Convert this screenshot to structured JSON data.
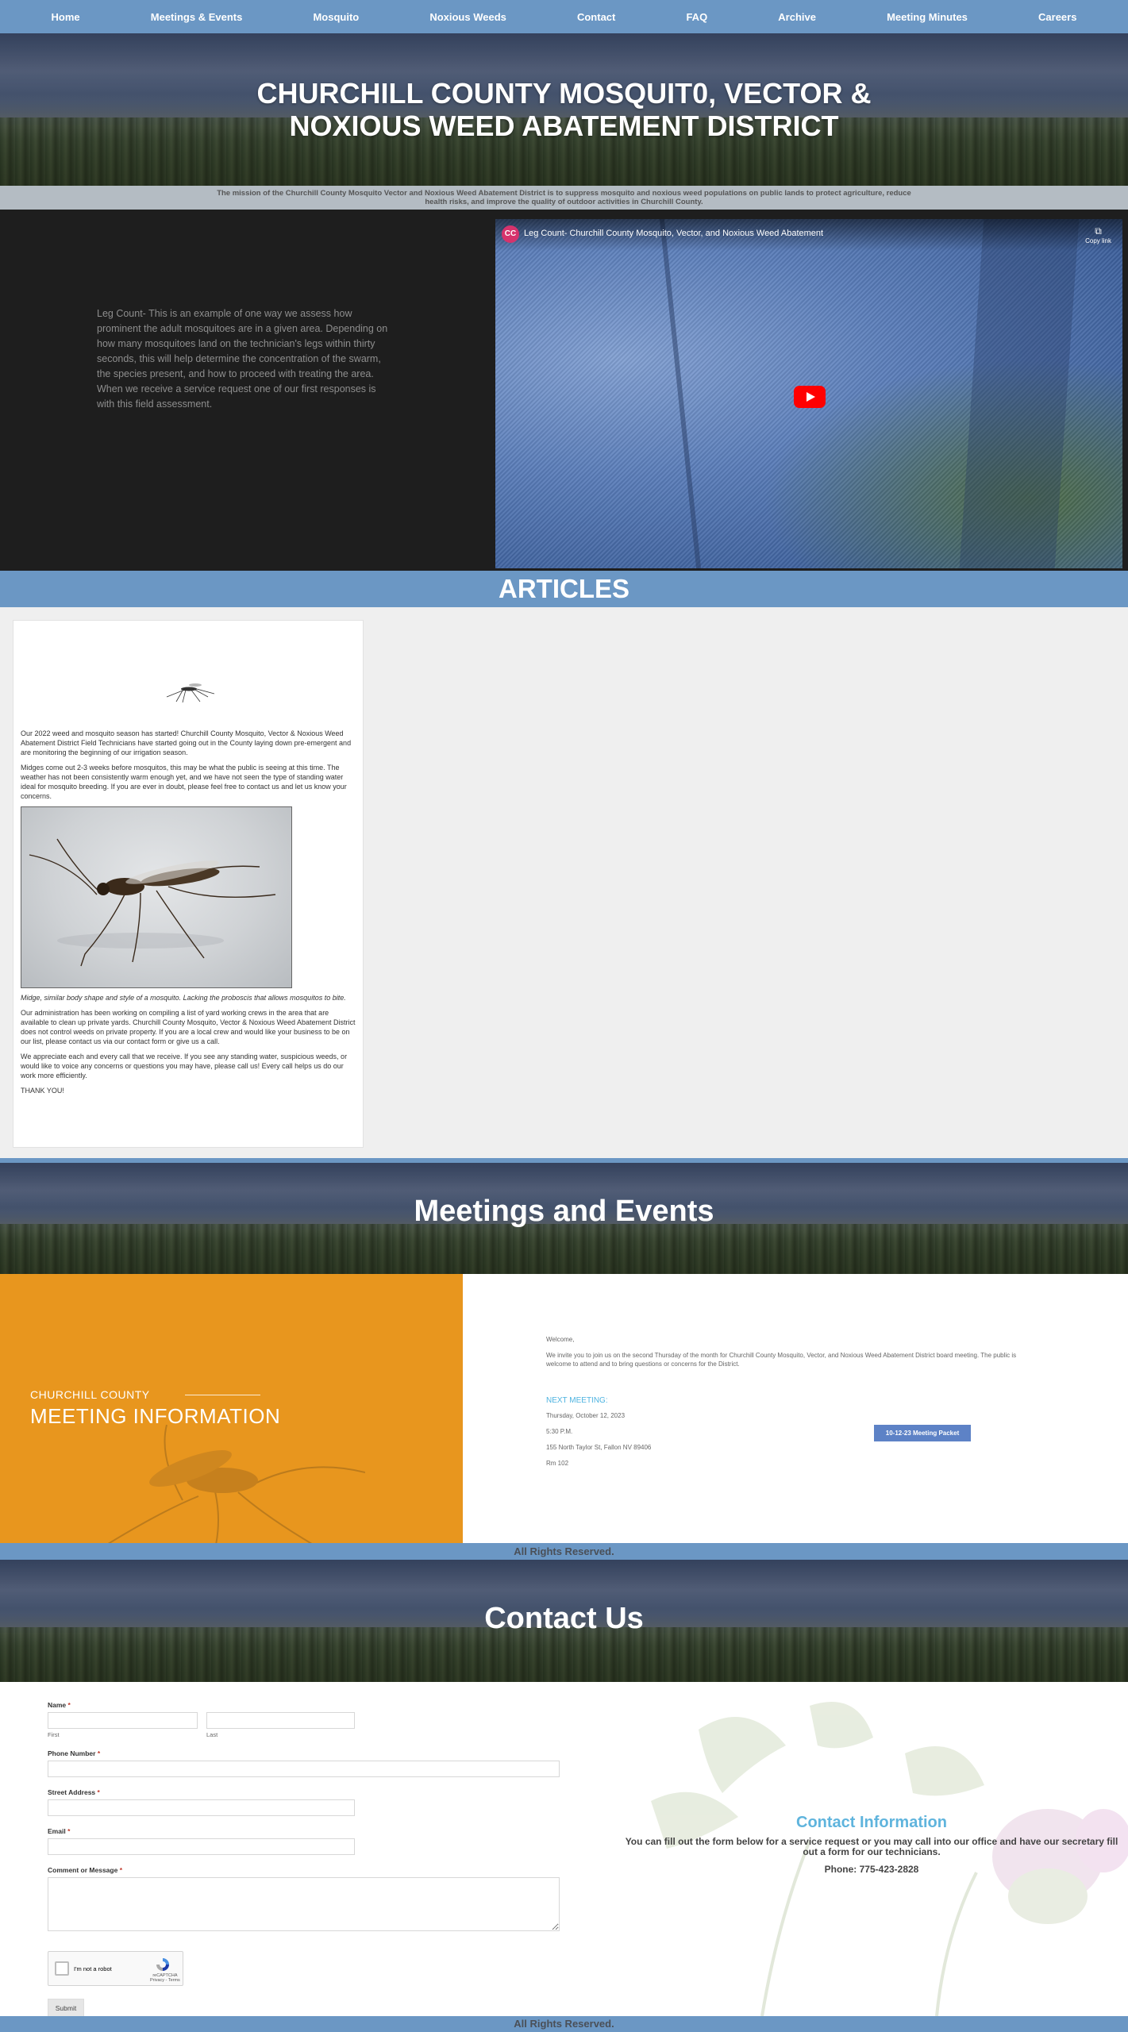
{
  "nav": {
    "items": [
      "Home",
      "Meetings & Events",
      "Mosquito",
      "Noxious Weeds",
      "Contact",
      "FAQ",
      "Archive",
      "Meeting Minutes",
      "Careers"
    ]
  },
  "hero": {
    "title_line1": "CHURCHILL COUNTY MOSQUIT0, VECTOR &",
    "title_line2": "NOXIOUS WEED ABATEMENT DISTRICT"
  },
  "mission": {
    "text": "The mission of the Churchill County Mosquito Vector and Noxious Weed Abatement District is to suppress mosquito and noxious weed populations on public lands to protect agriculture, reduce health risks, and improve the quality of outdoor activities in Churchill County."
  },
  "video": {
    "description": "Leg Count- This is an example of one way we assess how prominent the adult mosquitoes are in a given area. Depending on how many mosquitoes land on the technician's legs within thirty seconds, this will help determine the concentration of the swarm, the species present, and how to proceed with treating the area. When we receive a service request one of our first responses is with this field assessment.",
    "channel_initials": "CC",
    "title": "Leg Count- Churchill County Mosquito, Vector, and Noxious Weed Abatement",
    "copy_link": "Copy link",
    "icons": {
      "copy": "copy-icon",
      "play": "play-icon"
    }
  },
  "articles": {
    "heading": "ARTICLES",
    "p1": "Our 2022 weed and mosquito season has started! Churchill County Mosquito, Vector & Noxious Weed Abatement District Field Technicians have started going out in the County laying down pre-emergent and are monitoring the beginning of our irrigation season.",
    "p2": "Midges come out 2-3 weeks before mosquitos, this may be what the public is seeing at this time. The weather has not been consistently warm enough yet, and we have not seen the type of standing water ideal for mosquito breeding. If you are ever in doubt, please feel free to contact us and let us know your concerns.",
    "caption": "Midge, similar body shape and style of a mosquito. Lacking the proboscis that allows mosquitos to bite.",
    "p3": "Our administration has been working on compiling a list of yard working crews in the area that are available to clean up private yards. Churchill County Mosquito, Vector & Noxious Weed Abatement District does not control weeds on private property. If you are a local crew and would like your business to be on our list, please contact us via our contact form or give us a call.",
    "p4": "We appreciate each and every call that we receive. If you see any standing water, suspicious weeds, or would like to voice any concerns or questions you may have, please call us! Every call helps us do our work more efficiently.",
    "p5": "THANK YOU!"
  },
  "meetings": {
    "heading": "Meetings and Events",
    "left_sub": "CHURCHILL COUNTY",
    "left_main": "MEETING INFORMATION",
    "welcome": "Welcome,",
    "invite": "We invite you to join us on the second Thursday of the month for Churchill County Mosquito, Vector, and Noxious Weed Abatement District board meeting. The public is welcome to attend and to bring questions or concerns for the District.",
    "next_label": "NEXT MEETING:",
    "date": "Thursday, October 12, 2023",
    "time": "5:30 P.M.",
    "address": "155 North Taylor St, Fallon NV 89406",
    "room": "Rm 102",
    "packet_button": "10-12-23 Meeting Packet"
  },
  "footer": {
    "rights": "All Rights Reserved."
  },
  "contact": {
    "heading": "Contact Us",
    "form": {
      "name_label": "Name",
      "first_label": "First",
      "last_label": "Last",
      "phone_label": "Phone Number",
      "address_label": "Street Address",
      "email_label": "Email",
      "comment_label": "Comment or Message",
      "required_mark": "*",
      "captcha_text": "I'm not a robot",
      "captcha_brand": "reCAPTCHA",
      "captcha_links": "Privacy - Terms",
      "submit_label": "Submit"
    },
    "info": {
      "heading": "Contact Information",
      "description": "You can fill out the form below for a service request or you may call into our office and have our secretary fill out a form for our technicians.",
      "phone": "Phone: 775-423-2828"
    }
  },
  "colors": {
    "nav_blue": "#6b97c4",
    "meeting_orange": "#e8961e",
    "packet_blue": "#5d82c6",
    "info_blue": "#5fb4dd",
    "youtube_red": "#ff0000"
  }
}
